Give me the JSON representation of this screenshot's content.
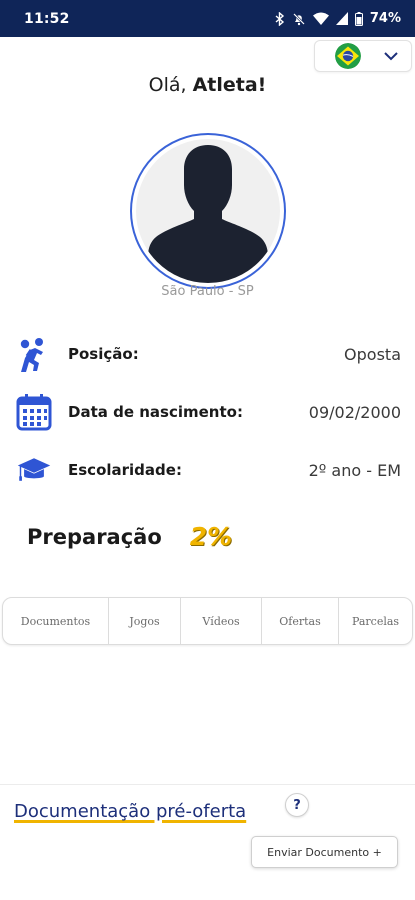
{
  "status_bar": {
    "time": "11:52",
    "battery": "74%",
    "icons": [
      "bluetooth-icon",
      "mute-icon",
      "wifi-icon",
      "signal-icon",
      "battery-icon"
    ]
  },
  "language_selector": {
    "flag": "brazil-flag-icon",
    "chevron": "chevron-down-icon"
  },
  "greeting": {
    "prefix": "Olá,",
    "name": "Atleta!"
  },
  "profile": {
    "location": "São Paulo - SP",
    "avatar": "person-silhouette-icon"
  },
  "info_rows": [
    {
      "icon": "volleyball-player-icon",
      "label": "Posição:",
      "value": "Oposta"
    },
    {
      "icon": "calendar-icon",
      "label": "Data de nascimento:",
      "value": "09/02/2000"
    },
    {
      "icon": "graduation-cap-icon",
      "label": "Escolaridade:",
      "value": "2º ano - EM"
    }
  ],
  "preparation": {
    "label": "Preparação",
    "value": "2%"
  },
  "tabs": [
    {
      "label": "Documentos"
    },
    {
      "label": "Jogos"
    },
    {
      "label": "Vídeos"
    },
    {
      "label": "Ofertas"
    },
    {
      "label": "Parcelas"
    }
  ],
  "documents": {
    "title": "Documentação pré-oferta",
    "help": "?",
    "send_button": "Enviar Documento +"
  },
  "colors": {
    "status_bar": "#0f2558",
    "accent_blue": "#2f55d4",
    "accent_yellow": "#f0b400",
    "title_blue": "#1d2f7a"
  }
}
